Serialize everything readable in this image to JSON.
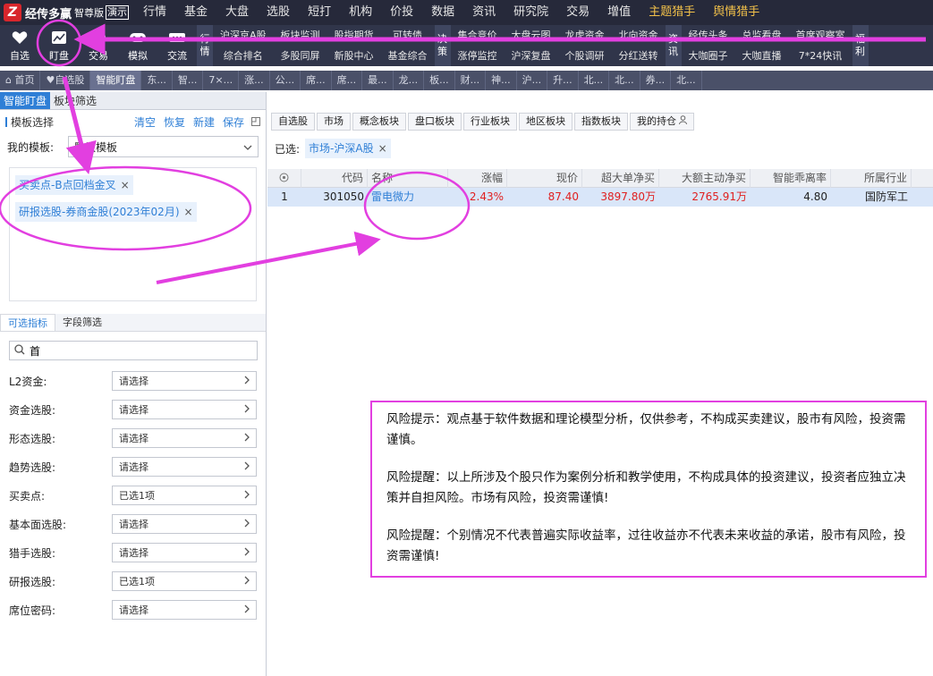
{
  "app": {
    "logo_char": "Z",
    "name": "经传多赢",
    "edition": "智尊版",
    "demo": "演示"
  },
  "menu": [
    "行情",
    "基金",
    "大盘",
    "选股",
    "短打",
    "机构",
    "价投",
    "数据",
    "资讯",
    "研究院",
    "交易",
    "增值",
    "主题猎手",
    "舆情猎手"
  ],
  "menu_highlight": [
    12,
    13
  ],
  "toolbar": {
    "buttons": [
      {
        "label": "自选",
        "icon": "heart-icon"
      },
      {
        "label": "盯盘",
        "icon": "chart-monitor-icon"
      },
      {
        "label": "交易",
        "icon": "clock-icon"
      },
      {
        "label": "模拟",
        "icon": "gamepad-icon"
      },
      {
        "label": "交流",
        "icon": "chat-icon"
      }
    ],
    "groups": [
      {
        "tag": [
          "行",
          "情"
        ],
        "items": [
          "沪深京A股",
          "综合排名",
          "板块监测",
          "多股同屏",
          "股指期货",
          "新股中心",
          "可转债",
          "基金综合"
        ]
      },
      {
        "tag": [
          "决",
          "策"
        ],
        "items": [
          "集合竞价",
          "涨停监控",
          "大盘云图",
          "沪深复盘",
          "龙虎资金",
          "个股调研",
          "北向资金",
          "分红送转"
        ]
      },
      {
        "tag": [
          "资",
          "讯"
        ],
        "items": [
          "经传头条",
          "大咖圈子",
          "总监看盘",
          "大咖直播",
          "首席观察室",
          "7*24快讯"
        ]
      },
      {
        "tag": [
          "福",
          "利"
        ],
        "items": [
          "",
          ""
        ]
      }
    ]
  },
  "page_tabs": [
    "首页",
    "自选股",
    "智能盯盘",
    "东...",
    "智...",
    "7×...",
    "涨...",
    "公...",
    "席...",
    "席...",
    "最...",
    "龙...",
    "板...",
    "财...",
    "神...",
    "沪...",
    "升...",
    "北...",
    "北...",
    "券...",
    "北..."
  ],
  "page_tabs_active": 2,
  "left": {
    "tabs": [
      "智能盯盘",
      "板块筛选"
    ],
    "template_title": "模板选择",
    "actions": [
      "清空",
      "恢复",
      "新建",
      "保存"
    ],
    "my_template_label": "我的模板:",
    "my_template_value": "默认模板",
    "chips": [
      "买卖点-B点回档金叉",
      "研报选股-券商金股(2023年02月)"
    ],
    "sub_tabs": [
      "可选指标",
      "字段筛选"
    ],
    "search_value": "首",
    "filters": [
      {
        "label": "L2资金:",
        "value": "请选择"
      },
      {
        "label": "资金选股:",
        "value": "请选择"
      },
      {
        "label": "形态选股:",
        "value": "请选择"
      },
      {
        "label": "趋势选股:",
        "value": "请选择"
      },
      {
        "label": "买卖点:",
        "value": "已选1项"
      },
      {
        "label": "基本面选股:",
        "value": "请选择"
      },
      {
        "label": "猎手选股:",
        "value": "请选择"
      },
      {
        "label": "研报选股:",
        "value": "已选1项"
      },
      {
        "label": "席位密码:",
        "value": "请选择"
      }
    ]
  },
  "right": {
    "category_tabs": [
      "自选股",
      "市场",
      "概念板块",
      "盘口板块",
      "行业板块",
      "地区板块",
      "指数板块",
      "我的持仓"
    ],
    "selected_label": "已选:",
    "selected_chip": "市场-沪深A股",
    "table": {
      "headers": [
        "",
        "代码",
        "名称",
        "涨幅",
        "现价",
        "超大单净买",
        "大额主动净买",
        "智能乖离率",
        "所属行业"
      ],
      "rows": [
        [
          "1",
          "301050",
          "雷电微力",
          "2.43%",
          "87.40",
          "3897.80万",
          "2765.91万",
          "4.80",
          "国防军工"
        ]
      ]
    }
  },
  "risk": [
    "风险提示：观点基于软件数据和理论模型分析，仅供参考，不构成买卖建议，股市有风险，投资需谨慎。",
    "风险提醒：以上所涉及个股只作为案例分析和教学使用，不构成具体的投资建议，投资者应独立决策并自担风险。市场有风险，投资需谨慎!",
    "风险提醒：个别情况不代表普遍实际收益率，过往收益亦不代表未来收益的承诺，股市有风险，投资需谨慎!"
  ],
  "colors": {
    "annotation": "#e23fe0",
    "accent_blue": "#2f7fd6",
    "up_red": "#e02020"
  }
}
